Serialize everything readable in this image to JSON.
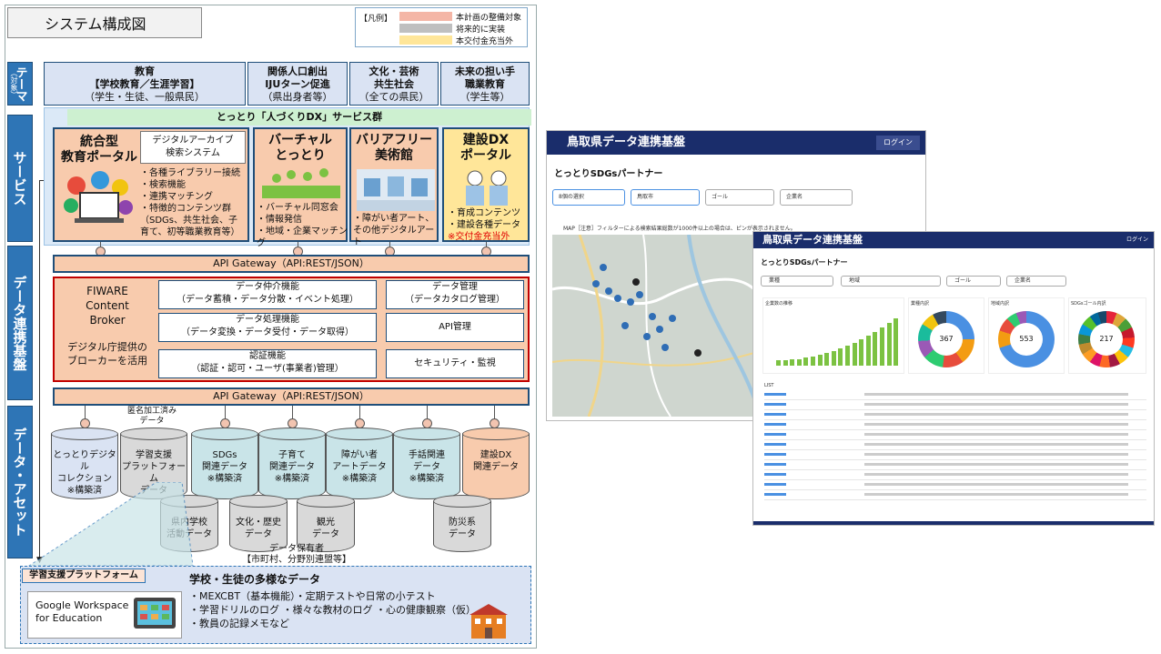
{
  "diagram": {
    "title": "システム構成図",
    "legend": {
      "header": "【凡例】",
      "items": [
        {
          "label": "本計画の整備対象",
          "color": "#f4b6a6"
        },
        {
          "label": "将来的に実装",
          "color": "#bfbfbf"
        },
        {
          "label": "本交付金充当外",
          "color": "#ffe699"
        }
      ]
    },
    "sections": {
      "theme": "テーマ",
      "theme_sub": "（対象）",
      "service": "サービス",
      "data_platform": "データ連携基盤",
      "data_asset": "データ・アセット"
    },
    "themes": [
      {
        "line1": "教育",
        "line2": "【学校教育／生涯学習】",
        "line3": "（学生・生徒、一般県民）"
      },
      {
        "line1": "関係人口創出",
        "line2": "IJUターン促進",
        "line3": "（県出身者等）"
      },
      {
        "line1": "文化・芸術",
        "line2": "共生社会",
        "line3": "（全ての県民）"
      },
      {
        "line1": "未来の担い手",
        "line2": "職業教育",
        "line3": "（学生等）"
      }
    ],
    "service_banner": "とっとり「人づくりDX」サービス群",
    "services": {
      "portal": {
        "title1": "統合型",
        "title2": "教育ポータル",
        "archive_line1": "デジタルアーカイブ",
        "archive_line2": "検索システム",
        "bullets": [
          "・各種ライブラリー接続",
          "・検索機能",
          "・連携マッチング",
          "・特徴的コンテンツ群"
        ],
        "note1": "（SDGs、共生社会、子",
        "note2": "育て、初等職業教育等）"
      },
      "virtual": {
        "title1": "バーチャル",
        "title2": "とっとり",
        "bullets": [
          "・バーチャル同窓会",
          "・情報発信",
          "・地域・企業マッチング"
        ]
      },
      "museum": {
        "title1": "バリアフリー",
        "title2": "美術館",
        "bullets": [
          "・障がい者アート、",
          "その他デジタルアート"
        ]
      },
      "construction": {
        "title1": "建設DX",
        "title2": "ポータル",
        "bullets": [
          "・育成コンテンツ",
          "・建設各種データ"
        ],
        "note": "※交付金充当外"
      }
    },
    "api_gateway_top": "API Gateway（API:REST/JSON）",
    "api_gateway_bottom": "API Gateway（API:REST/JSON）",
    "broker": {
      "name1": "FIWARE",
      "name2": "Content",
      "name3": "Broker",
      "note1": "デジタル庁提供の",
      "note2": "ブローカーを活用"
    },
    "functions": [
      {
        "title": "データ仲介機能",
        "sub": "（データ蓄積・データ分散・イベント処理）"
      },
      {
        "title": "データ処理機能",
        "sub": "（データ変換・データ受付・データ取得）"
      },
      {
        "title": "認証機能",
        "sub": "（認証・認可・ユーザ(事業者)管理）"
      }
    ],
    "mgmt": [
      {
        "title": "データ管理",
        "sub": "（データカタログ管理）"
      },
      {
        "title": "API管理",
        "sub": ""
      },
      {
        "title": "セキュリティ・監視",
        "sub": ""
      }
    ],
    "anon_label1": "匿名加工済み",
    "anon_label2": "データ",
    "assets_row1": [
      {
        "l1": "とっとりデジタル",
        "l2": "コレクション",
        "l3": "※構築済",
        "color": "#dae3f3"
      },
      {
        "l1": "学習支援",
        "l2": "プラットフォーム",
        "l3": "データ",
        "color": "#d9d9d9"
      },
      {
        "l1": "SDGs",
        "l2": "関連データ",
        "l3": "※構築済",
        "color": "#c9e4e8"
      },
      {
        "l1": "子育て",
        "l2": "関連データ",
        "l3": "※構築済",
        "color": "#c9e4e8"
      },
      {
        "l1": "障がい者",
        "l2": "アートデータ",
        "l3": "※構築済",
        "color": "#c9e4e8"
      },
      {
        "l1": "手話関連",
        "l2": "データ",
        "l3": "※構築済",
        "color": "#c9e4e8"
      },
      {
        "l1": "建設DX",
        "l2": "関連データ",
        "l3": "",
        "color": "#f8cbad"
      }
    ],
    "assets_row2": [
      {
        "l1": "県内学校",
        "l2": "活動データ"
      },
      {
        "l1": "文化・歴史",
        "l2": "データ"
      },
      {
        "l1": "観光",
        "l2": "データ"
      },
      {
        "l1": "防災系",
        "l2": "データ"
      }
    ],
    "holder1": "データ保有者",
    "holder2": "【市町村、分野別連盟等】",
    "learning_platform": {
      "tag": "学習支援プラットフォーム",
      "workspace1": "Google Workspace",
      "workspace2": "for Education",
      "heading": "学校・生徒の多様なデータ",
      "items": [
        "・MEXCBT（基本機能）・定期テストや日常の小テスト",
        "・学習ドリルのログ ・様々な教材のログ ・心の健康観察（仮）",
        "・教員の記録メモなど"
      ]
    }
  },
  "screenshot_back": {
    "header": "鳥取県データ連携基盤",
    "login": "ログイン",
    "title": "とっとりSDGsパートナー",
    "filters": [
      "8個の選択",
      "鳥取市",
      "ゴール",
      "企業名"
    ],
    "map_note": "MAP［注意］フィルターによる検索結果総数が1000件以上の場合は、ピンが表示されません。"
  },
  "screenshot_front": {
    "header": "鳥取県データ連携基盤",
    "login": "ログイン",
    "title": "とっとりSDGsパートナー",
    "filters": [
      "業種",
      "地域",
      "ゴール",
      "企業名"
    ],
    "panels": [
      "企業数の推移",
      "業種内訳",
      "地域内訳",
      "SDGsゴール内訳"
    ],
    "donut_values": [
      "367",
      "553",
      "217"
    ],
    "list_label": "LIST"
  }
}
